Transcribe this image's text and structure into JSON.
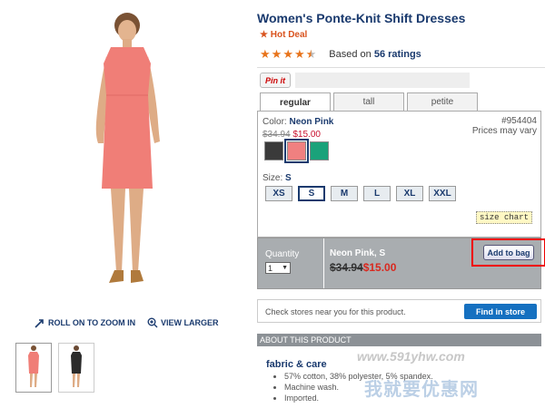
{
  "product": {
    "title": "Women's Ponte-Knit Shift Dresses",
    "hot_deal": "Hot Deal",
    "rating_count_text": "Based on",
    "rating_count": "56 ratings",
    "rating_value": 4.5,
    "star_color": "#e8741c"
  },
  "share": {
    "pin_label": "Pin it"
  },
  "fit_tabs": [
    {
      "label": "regular",
      "active": true
    },
    {
      "label": "tall",
      "active": false
    },
    {
      "label": "petite",
      "active": false
    }
  ],
  "options": {
    "color_prefix": "Color:",
    "color_name": "Neon Pink",
    "style_number": "#954404",
    "prices_may_vary": "Prices may vary",
    "old_price": "$34.94",
    "new_price": "$15.00",
    "swatches": [
      {
        "name": "charcoal",
        "color": "#3a3a3a"
      },
      {
        "name": "neon-pink",
        "color": "#f08080"
      },
      {
        "name": "green",
        "color": "#1aa27a"
      }
    ],
    "size_prefix": "Size:",
    "size_selected": "S",
    "sizes": [
      "XS",
      "S",
      "M",
      "L",
      "XL",
      "XXL"
    ],
    "size_chart": "size chart"
  },
  "purchase": {
    "quantity_label": "Quantity",
    "quantity_value": "1",
    "summary_name": "Neon Pink, S",
    "summary_old_price": "$34.94",
    "summary_new_price": "$15.00",
    "add_to_bag": "Add to bag"
  },
  "store": {
    "check_text": "Check stores near you for this product.",
    "find_button": "Find in store"
  },
  "about": {
    "header": "ABOUT THIS PRODUCT",
    "fabric_title": "fabric & care",
    "fabric_items": [
      "57% cotton, 38% polyester, 5% spandex.",
      "Machine wash.",
      "Imported."
    ]
  },
  "image_links": {
    "zoom": "ROLL ON TO ZOOM IN",
    "larger": "VIEW LARGER"
  },
  "watermark": {
    "url": "www.591yhw.com",
    "cn": "我就要优惠网"
  }
}
